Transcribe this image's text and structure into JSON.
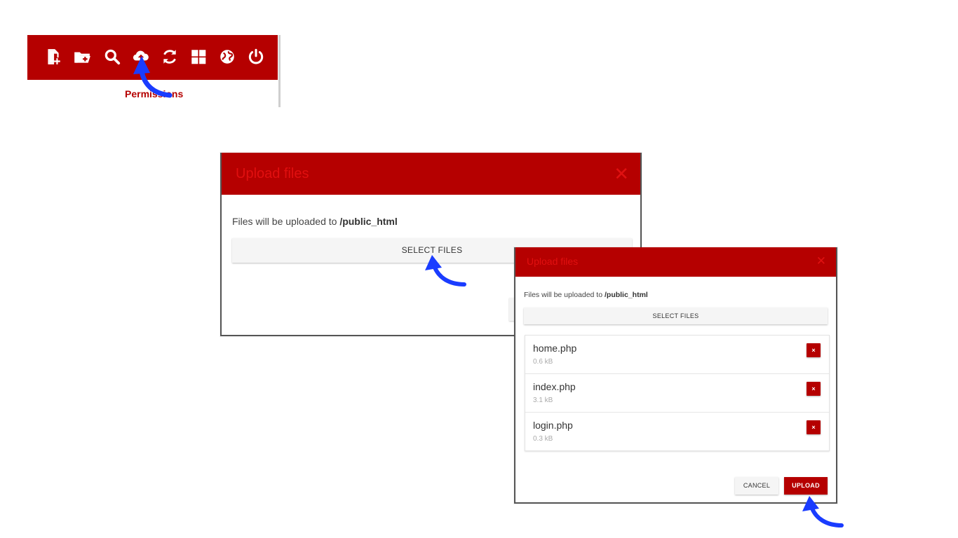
{
  "toolbar": {
    "icons": [
      "new-file-icon",
      "new-folder-icon",
      "search-icon",
      "upload-cloud-icon",
      "refresh-icon",
      "grid-view-icon",
      "globe-icon",
      "power-icon"
    ],
    "permissions_label": "Permissions",
    "color": "#b50000"
  },
  "upload_dialog_1": {
    "title": "Upload files",
    "close_glyph": "✕",
    "destination_prefix": "Files will be uploaded to ",
    "destination_path": "/public_html",
    "select_files_label": "SELECT FILES"
  },
  "upload_dialog_2": {
    "title": "Upload files",
    "close_glyph": "✕",
    "destination_prefix": "Files will be uploaded to ",
    "destination_path": "/public_html",
    "select_files_label": "SELECT FILES",
    "files": [
      {
        "name": "home.php",
        "size": "0.6 kB"
      },
      {
        "name": "index.php",
        "size": "3.1 kB"
      },
      {
        "name": "login.php",
        "size": "0.3 kB"
      }
    ],
    "remove_glyph": "×",
    "cancel_label": "CANCEL",
    "upload_label": "UPLOAD"
  },
  "colors": {
    "brand_red": "#b50000",
    "pointer_arrow": "#1a3cff"
  }
}
